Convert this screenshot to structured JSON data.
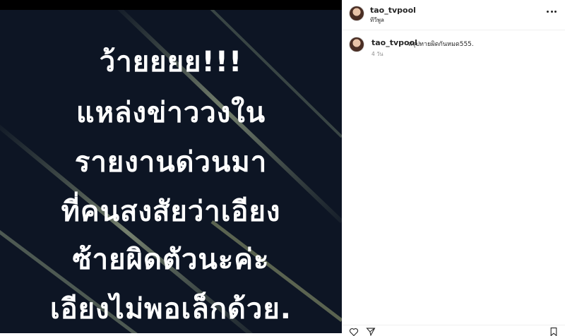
{
  "post": {
    "image_lines": [
      "ว้ายยยย!!!",
      "แหล่งข่าววงใน",
      "รายงานด่วนมา",
      "ที่คนสงสัยว่าเอียง",
      "ซ้ายผิดตัวนะค่ะ",
      "เอียงไม่พอเล็กด้วย."
    ]
  },
  "header": {
    "username": "tao_tvpool",
    "location": "ทีวีพูล",
    "more_icon": "more-horizontal-icon"
  },
  "caption": {
    "username": "tao_tvpool",
    "text": "สรุปทายผิดกันหมด555.",
    "time": "4 วัน"
  },
  "actions": {
    "icons": [
      "heart-icon",
      "share-icon",
      "bookmark-icon"
    ]
  },
  "colors": {
    "image_bg": "#0d1524",
    "text": "#262626",
    "muted": "#8e8e8e"
  }
}
